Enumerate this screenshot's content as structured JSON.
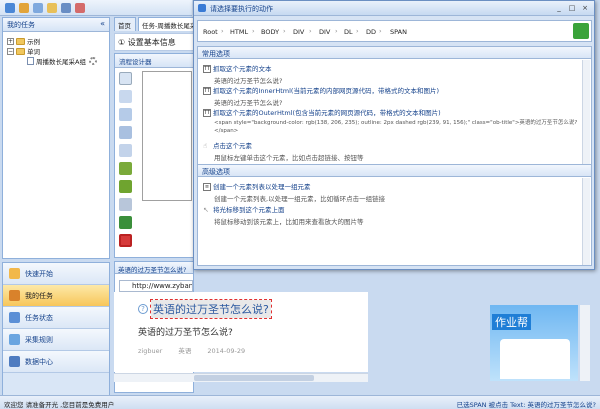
{
  "left_panel": {
    "title": "我的任务",
    "collapse_glyph": "«",
    "tree": [
      {
        "label": "示例"
      },
      {
        "label": "单词"
      },
      {
        "label": "周播数长尾采A组"
      }
    ]
  },
  "nav": [
    {
      "label": "快速开始"
    },
    {
      "label": "我的任务"
    },
    {
      "label": "任务状态"
    },
    {
      "label": "采集规则"
    },
    {
      "label": "数据中心"
    }
  ],
  "tabs": [
    {
      "label": "首页"
    },
    {
      "label": "任务-周播数长尾采A组"
    }
  ],
  "setting_bar": "① 设置基本信息",
  "designer": {
    "title": "流程设计器"
  },
  "browser": {
    "tab_title": "英语的过万圣节怎么说?",
    "url": "http://www.zybang.com",
    "question": "英语的过万圣节怎么说?",
    "answer": "英语的过万圣节怎么说?",
    "meta": "zigbuer 英语 2014-09-29",
    "ad_title": "作业帮"
  },
  "status": {
    "left": "欢迎您 请准备开光 ,您目前是免费用户",
    "right": "已选SPAN 被点击 Text: 英语的过万圣节怎么说?"
  },
  "dialog": {
    "title": "请选择要执行的动作",
    "crumbs": [
      "Root",
      "HTML",
      "BODY",
      "DIV",
      "DIV",
      "DL",
      "DD",
      "SPAN"
    ],
    "common": {
      "title": "常用选项",
      "options": [
        {
          "main": "抓取这个元素的文本",
          "sub": "英语的过万圣节怎么说?"
        },
        {
          "main": "抓取这个元素的InnerHtml(当前元素的内部网页源代码，带格式的文本和图片)",
          "sub": "英语的过万圣节怎么说?"
        },
        {
          "main": "抓取这个元素的OuterHtml(包含当前元素的网页源代码，带格式的文本和图片)",
          "sub": "<span style=\"background-color: rgb(138, 206, 235); outline: 2px dashed rgb(239, 91, 156);\" class=\"ob-title\">英语的过万圣节怎么说?</span>"
        },
        {
          "main": "点击这个元素",
          "sub": "用鼠标左键单击这个元素，比如点击超链接、按钮等"
        }
      ]
    },
    "advanced": {
      "title": "高级选项",
      "options": [
        {
          "main": "创建一个元素列表以处理一组元素",
          "sub": "创建一个元素列表,以处理一组元素，比如循环点击一组链接"
        },
        {
          "main": "将光标移到这个元素上面",
          "sub": "将鼠标移动到该元素上，比如用来查看放大的图片等"
        }
      ]
    },
    "win_buttons": [
      "_",
      "□",
      "×"
    ]
  }
}
